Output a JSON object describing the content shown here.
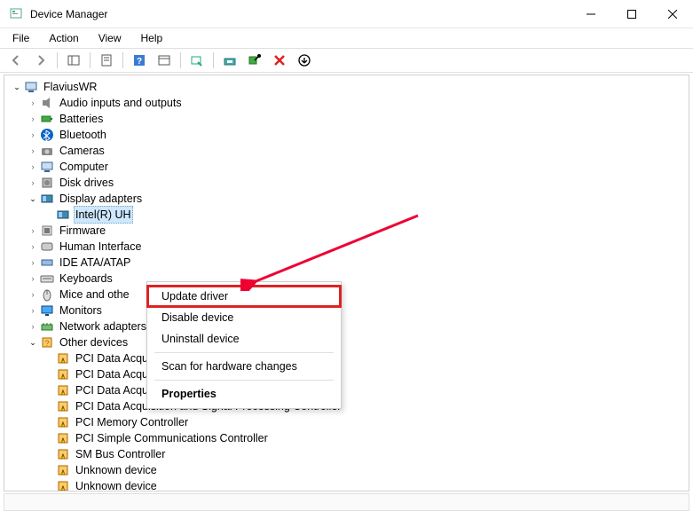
{
  "window": {
    "title": "Device Manager"
  },
  "menu": {
    "file": "File",
    "action": "Action",
    "view": "View",
    "help": "Help"
  },
  "tree": {
    "root": "FlaviusWR",
    "cats": [
      {
        "label": "Audio inputs and outputs",
        "open": false,
        "icon": "audio"
      },
      {
        "label": "Batteries",
        "open": false,
        "icon": "battery"
      },
      {
        "label": "Bluetooth",
        "open": false,
        "icon": "bt"
      },
      {
        "label": "Cameras",
        "open": false,
        "icon": "camera"
      },
      {
        "label": "Computer",
        "open": false,
        "icon": "pc"
      },
      {
        "label": "Disk drives",
        "open": false,
        "icon": "disk"
      },
      {
        "label": "Display adapters",
        "open": true,
        "icon": "gpu",
        "children": [
          {
            "label": "Intel(R) UH",
            "icon": "gpu",
            "selected": true
          }
        ]
      },
      {
        "label": "Firmware",
        "open": false,
        "icon": "fw"
      },
      {
        "label": "Human Interface",
        "open": false,
        "icon": "hid",
        "cut": true
      },
      {
        "label": "IDE ATA/ATAP",
        "open": false,
        "icon": "ide",
        "cut": true
      },
      {
        "label": "Keyboards",
        "open": false,
        "icon": "kb"
      },
      {
        "label": "Mice and othe",
        "open": false,
        "icon": "mouse",
        "cut": true
      },
      {
        "label": "Monitors",
        "open": false,
        "icon": "mon"
      },
      {
        "label": "Network adapters",
        "open": false,
        "icon": "net"
      },
      {
        "label": "Other devices",
        "open": true,
        "icon": "other",
        "children": [
          {
            "label": "PCI Data Acquisition and Signal Processing Controller",
            "icon": "warn"
          },
          {
            "label": "PCI Data Acquisition and Signal Processing Controller",
            "icon": "warn"
          },
          {
            "label": "PCI Data Acquisition and Signal Processing Controller",
            "icon": "warn"
          },
          {
            "label": "PCI Data Acquisition and Signal Processing Controller",
            "icon": "warn"
          },
          {
            "label": "PCI Memory Controller",
            "icon": "warn"
          },
          {
            "label": "PCI Simple Communications Controller",
            "icon": "warn"
          },
          {
            "label": "SM Bus Controller",
            "icon": "warn"
          },
          {
            "label": "Unknown device",
            "icon": "warn"
          },
          {
            "label": "Unknown device",
            "icon": "warn"
          }
        ]
      }
    ]
  },
  "ctx": {
    "update": "Update driver",
    "disable": "Disable device",
    "uninstall": "Uninstall device",
    "scan": "Scan for hardware changes",
    "props": "Properties"
  }
}
